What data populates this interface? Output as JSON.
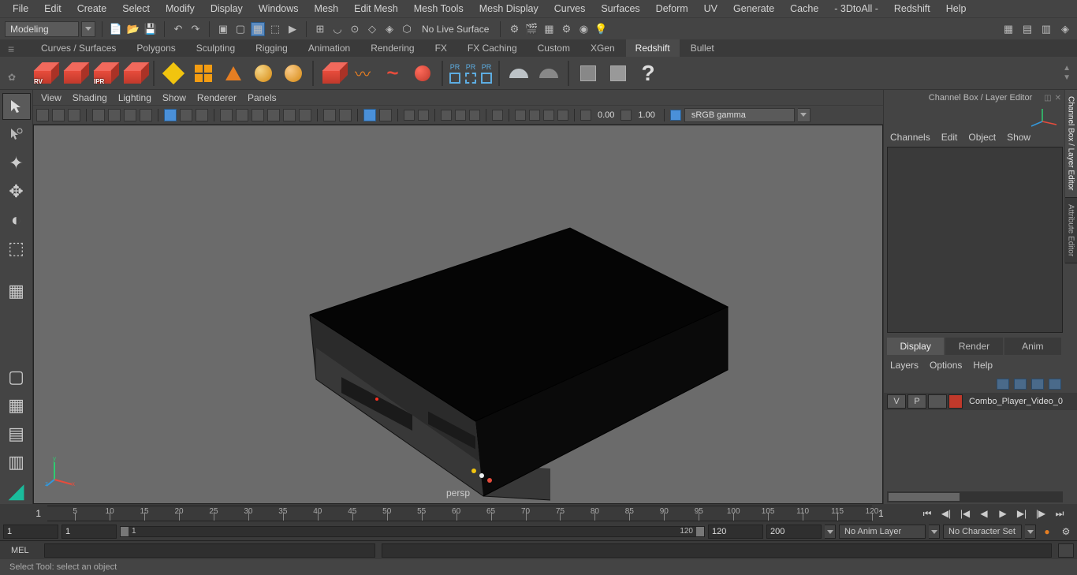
{
  "menubar": [
    "File",
    "Edit",
    "Create",
    "Select",
    "Modify",
    "Display",
    "Windows",
    "Mesh",
    "Edit Mesh",
    "Mesh Tools",
    "Mesh Display",
    "Curves",
    "Surfaces",
    "Deform",
    "UV",
    "Generate",
    "Cache",
    "- 3DtoAll -",
    "Redshift",
    "Help"
  ],
  "workspace": "Modeling",
  "no_live_surface": "No Live Surface",
  "shelf_tabs": [
    "Curves / Surfaces",
    "Polygons",
    "Sculpting",
    "Rigging",
    "Animation",
    "Rendering",
    "FX",
    "FX Caching",
    "Custom",
    "XGen",
    "Redshift",
    "Bullet"
  ],
  "shelf_active": "Redshift",
  "redcube_labels": [
    "RV",
    "",
    "IPR",
    ""
  ],
  "panel_menubar": [
    "View",
    "Shading",
    "Lighting",
    "Show",
    "Renderer",
    "Panels"
  ],
  "panel_toolbar": {
    "num1": "0.00",
    "num2": "1.00",
    "color_dd": "sRGB gamma"
  },
  "persp_label": "persp",
  "channelbox_title": "Channel Box / Layer Editor",
  "channel_menu": [
    "Channels",
    "Edit",
    "Object",
    "Show"
  ],
  "layer_tabs": [
    "Display",
    "Render",
    "Anim"
  ],
  "layer_tab_active": "Display",
  "layer_menu": [
    "Layers",
    "Options",
    "Help"
  ],
  "layer_row": {
    "v": "V",
    "p": "P",
    "name": "Combo_Player_Video_0"
  },
  "vtabs": [
    "Channel Box / Layer Editor",
    "Attribute Editor"
  ],
  "timeline": {
    "start": 1,
    "end": 120,
    "ticks": [
      5,
      10,
      15,
      20,
      25,
      30,
      35,
      40,
      45,
      50,
      55,
      60,
      65,
      70,
      75,
      80,
      85,
      90,
      95,
      100,
      105,
      110,
      115,
      120
    ],
    "cur": 1
  },
  "range": {
    "a": 1,
    "b": 1,
    "range_a": 1,
    "range_b": 120,
    "c": 120,
    "d": 200
  },
  "anim_layer_dd": "No Anim Layer",
  "char_set_dd": "No Character Set",
  "cmd_label": "MEL",
  "helpline": "Select Tool: select an object"
}
